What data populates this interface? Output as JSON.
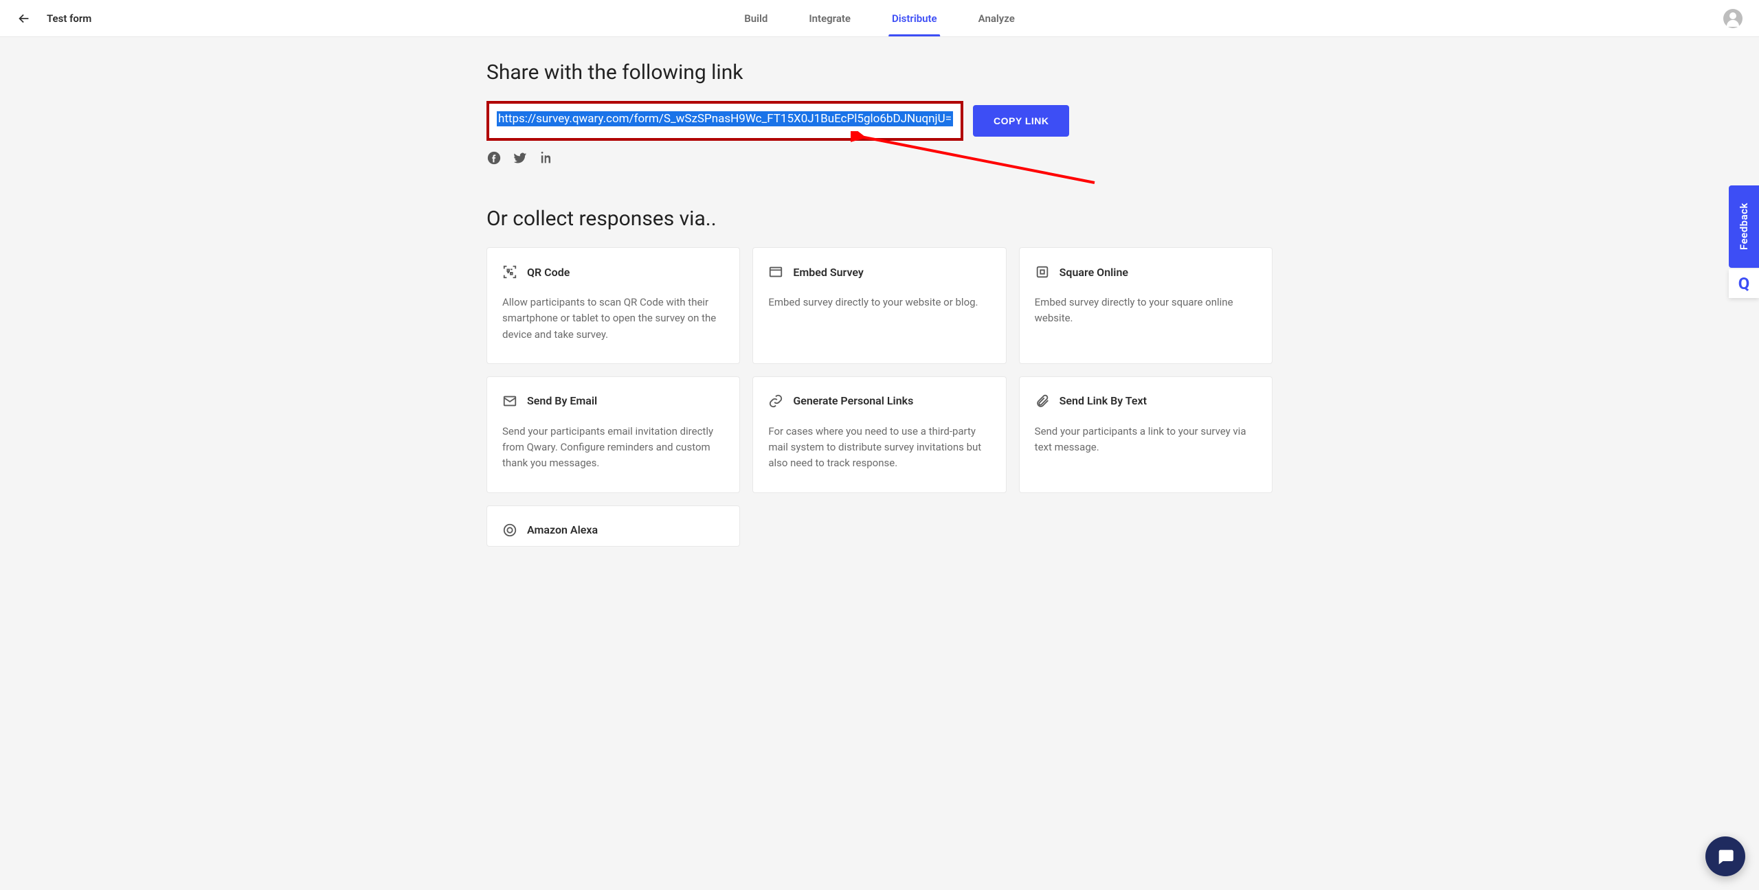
{
  "header": {
    "form_title": "Test form",
    "tabs": [
      "Build",
      "Integrate",
      "Distribute",
      "Analyze"
    ],
    "active_tab_index": 2
  },
  "share": {
    "heading": "Share with the following link",
    "url": "https://survey.qwary.com/form/S_wSzSPnasH9Wc_FT15X0J1BuEcPl5glo6bDJNuqnjU=",
    "copy_label": "COPY LINK",
    "social": {
      "facebook": "facebook-icon",
      "twitter": "twitter-icon",
      "linkedin": "linkedin-icon"
    }
  },
  "collect": {
    "heading": "Or collect responses via..",
    "options": [
      {
        "icon": "qr-icon",
        "title": "QR Code",
        "desc": "Allow participants to scan QR Code with their smartphone or tablet to open the survey on the device and take survey."
      },
      {
        "icon": "browser-icon",
        "title": "Embed Survey",
        "desc": "Embed survey directly to your website or blog."
      },
      {
        "icon": "square-icon",
        "title": "Square Online",
        "desc": "Embed survey directly to your square online website."
      },
      {
        "icon": "mail-icon",
        "title": "Send By Email",
        "desc": "Send your participants email invitation directly from Qwary. Configure reminders and custom thank you messages."
      },
      {
        "icon": "link-icon",
        "title": "Generate Personal Links",
        "desc": "For cases where you need to use a third-party mail system to distribute survey invitations but also need to track response."
      },
      {
        "icon": "paperclip-icon",
        "title": "Send Link By Text",
        "desc": "Send your participants a link to your survey via text message."
      },
      {
        "icon": "alexa-icon",
        "title": "Amazon Alexa",
        "desc": ""
      }
    ]
  },
  "side": {
    "feedback_label": "Feedback",
    "brand_glyph": "Q"
  },
  "annotations": {
    "highlight_color": "#b00000",
    "arrow_points_to": "share-url-input"
  }
}
